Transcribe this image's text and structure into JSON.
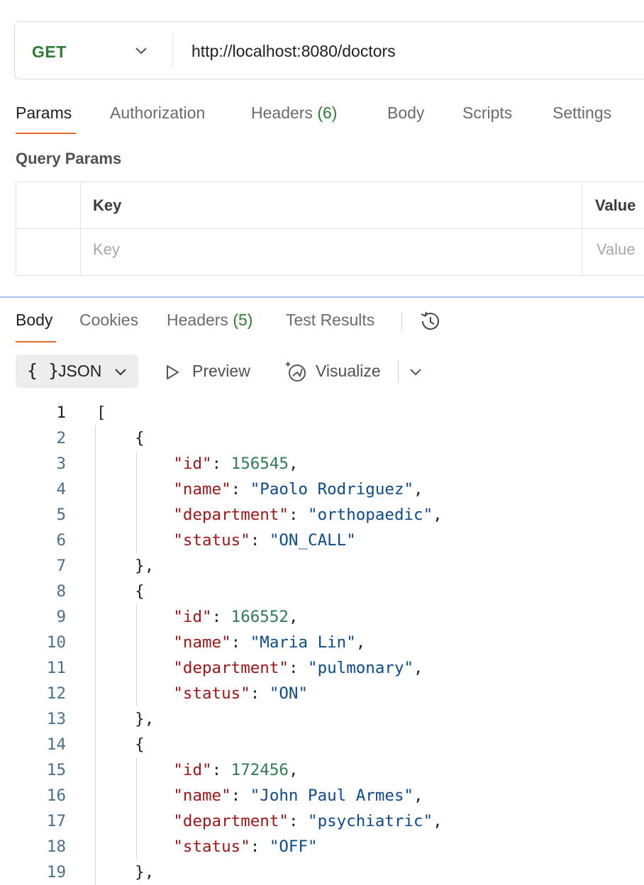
{
  "request": {
    "method": "GET",
    "url": "http://localhost:8080/doctors"
  },
  "request_tabs": [
    {
      "label": "Params",
      "count": ""
    },
    {
      "label": "Authorization",
      "count": ""
    },
    {
      "label": "Headers",
      "count": "(6)"
    },
    {
      "label": "Body",
      "count": ""
    },
    {
      "label": "Scripts",
      "count": ""
    },
    {
      "label": "Settings",
      "count": ""
    }
  ],
  "query_params": {
    "title": "Query Params",
    "key_header": "Key",
    "value_header": "Value",
    "key_placeholder": "Key",
    "value_placeholder": "Value"
  },
  "response_tabs": [
    {
      "label": "Body",
      "count": ""
    },
    {
      "label": "Cookies",
      "count": ""
    },
    {
      "label": "Headers",
      "count": "(5)"
    },
    {
      "label": "Test Results",
      "count": ""
    }
  ],
  "format_toolbar": {
    "format_braces": "{ }",
    "format_label": "JSON",
    "preview_label": "Preview",
    "visualize_label": "Visualize"
  },
  "code_lines": [
    {
      "n": "1",
      "text": "["
    },
    {
      "n": "2",
      "text": "    {"
    },
    {
      "n": "3",
      "text": "        \"id\": 156545,"
    },
    {
      "n": "4",
      "text": "        \"name\": \"Paolo Rodriguez\","
    },
    {
      "n": "5",
      "text": "        \"department\": \"orthopaedic\","
    },
    {
      "n": "6",
      "text": "        \"status\": \"ON_CALL\""
    },
    {
      "n": "7",
      "text": "    },"
    },
    {
      "n": "8",
      "text": "    {"
    },
    {
      "n": "9",
      "text": "        \"id\": 166552,"
    },
    {
      "n": "10",
      "text": "        \"name\": \"Maria Lin\","
    },
    {
      "n": "11",
      "text": "        \"department\": \"pulmonary\","
    },
    {
      "n": "12",
      "text": "        \"status\": \"ON\""
    },
    {
      "n": "13",
      "text": "    },"
    },
    {
      "n": "14",
      "text": "    {"
    },
    {
      "n": "15",
      "text": "        \"id\": 172456,"
    },
    {
      "n": "16",
      "text": "        \"name\": \"John Paul Armes\","
    },
    {
      "n": "17",
      "text": "        \"department\": \"psychiatric\","
    },
    {
      "n": "18",
      "text": "        \"status\": \"OFF\""
    },
    {
      "n": "19",
      "text": "    },"
    }
  ],
  "colors": {
    "accent": "#e8692f",
    "method_green": "#2e7d32",
    "json_key": "#a31515",
    "json_string": "#0b4a8f",
    "json_number": "#2e7d55"
  },
  "icons": [
    "chevron-down-icon",
    "history-icon",
    "play-icon",
    "visualize-icon"
  ]
}
